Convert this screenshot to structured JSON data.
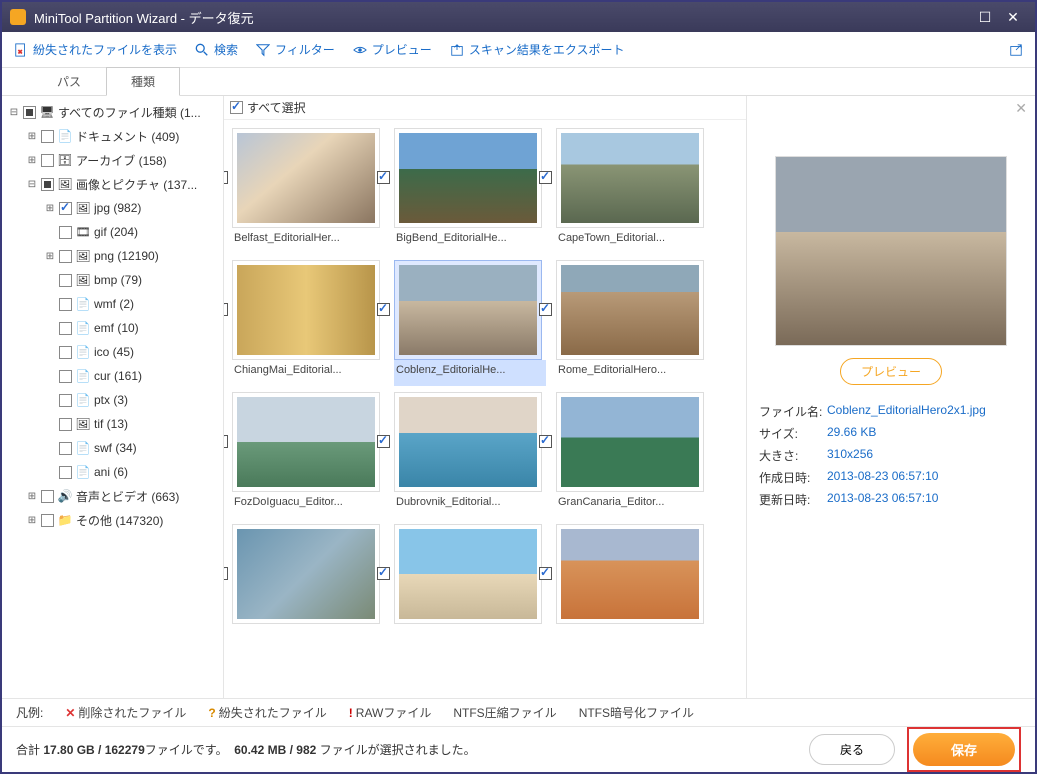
{
  "title": "MiniTool Partition Wizard - データ復元",
  "toolbar": {
    "show_lost": "紛失されたファイルを表示",
    "search": "検索",
    "filter": "フィルター",
    "preview": "プレビュー",
    "export": "スキャン結果をエクスポート"
  },
  "tabs": {
    "path": "パス",
    "type": "種類"
  },
  "tree": [
    {
      "depth": 0,
      "exp": "−",
      "cb": "partial",
      "icon": "🖥",
      "label": "すべてのファイル種類 (1..."
    },
    {
      "depth": 1,
      "exp": "+",
      "cb": "",
      "icon": "📄",
      "label": "ドキュメント (409)"
    },
    {
      "depth": 1,
      "exp": "+",
      "cb": "",
      "icon": "🗄",
      "label": "アーカイブ (158)"
    },
    {
      "depth": 1,
      "exp": "−",
      "cb": "partial",
      "icon": "🖼",
      "label": "画像とピクチャ (137..."
    },
    {
      "depth": 2,
      "exp": "+",
      "cb": "checked",
      "icon": "🖼",
      "label": "jpg (982)"
    },
    {
      "depth": 2,
      "exp": "",
      "cb": "",
      "icon": "🎞",
      "label": "gif (204)"
    },
    {
      "depth": 2,
      "exp": "+",
      "cb": "",
      "icon": "🖼",
      "label": "png (12190)"
    },
    {
      "depth": 2,
      "exp": "",
      "cb": "",
      "icon": "🖼",
      "label": "bmp (79)"
    },
    {
      "depth": 2,
      "exp": "",
      "cb": "",
      "icon": "📄",
      "label": "wmf (2)"
    },
    {
      "depth": 2,
      "exp": "",
      "cb": "",
      "icon": "📄",
      "label": "emf (10)"
    },
    {
      "depth": 2,
      "exp": "",
      "cb": "",
      "icon": "📄",
      "label": "ico (45)"
    },
    {
      "depth": 2,
      "exp": "",
      "cb": "",
      "icon": "📄",
      "label": "cur (161)"
    },
    {
      "depth": 2,
      "exp": "",
      "cb": "",
      "icon": "📄",
      "label": "ptx (3)"
    },
    {
      "depth": 2,
      "exp": "",
      "cb": "",
      "icon": "🖼",
      "label": "tif (13)"
    },
    {
      "depth": 2,
      "exp": "",
      "cb": "",
      "icon": "📄",
      "label": "swf (34)"
    },
    {
      "depth": 2,
      "exp": "",
      "cb": "",
      "icon": "📄",
      "label": "ani (6)"
    },
    {
      "depth": 1,
      "exp": "+",
      "cb": "",
      "icon": "🔊",
      "label": "音声とビデオ (663)"
    },
    {
      "depth": 1,
      "exp": "+",
      "cb": "",
      "icon": "📁",
      "label": "その他 (147320)"
    }
  ],
  "select_all": "すべて選択",
  "thumbs": [
    {
      "name": "Belfast_EditorialHer...",
      "g": "g1",
      "sel": false
    },
    {
      "name": "BigBend_EditorialHe...",
      "g": "g2",
      "sel": false
    },
    {
      "name": "CapeTown_Editorial...",
      "g": "g3",
      "sel": false
    },
    {
      "name": "ChiangMai_Editorial...",
      "g": "g4",
      "sel": false
    },
    {
      "name": "Coblenz_EditorialHe...",
      "g": "g5",
      "sel": true
    },
    {
      "name": "Rome_EditorialHero...",
      "g": "g6",
      "sel": false
    },
    {
      "name": "FozDoIguacu_Editor...",
      "g": "g7",
      "sel": false
    },
    {
      "name": "Dubrovnik_Editorial...",
      "g": "g8",
      "sel": false
    },
    {
      "name": "GranCanaria_Editor...",
      "g": "g9",
      "sel": false
    },
    {
      "name": "",
      "g": "g10",
      "sel": false
    },
    {
      "name": "",
      "g": "g11",
      "sel": false
    },
    {
      "name": "",
      "g": "g12",
      "sel": false
    }
  ],
  "preview": {
    "button": "プレビュー",
    "meta": [
      {
        "k": "ファイル名:",
        "v": "Coblenz_EditorialHero2x1.jpg"
      },
      {
        "k": "サイズ:",
        "v": "29.66 KB"
      },
      {
        "k": "大きさ:",
        "v": "310x256"
      },
      {
        "k": "作成日時:",
        "v": "2013-08-23 06:57:10"
      },
      {
        "k": "更新日時:",
        "v": "2013-08-23 06:57:10"
      }
    ]
  },
  "legend": {
    "title": "凡例:",
    "deleted": "削除されたファイル",
    "lost": "紛失されたファイル",
    "raw": "RAWファイル",
    "ntfs_comp": "NTFS圧縮ファイル",
    "ntfs_enc": "NTFS暗号化ファイル"
  },
  "footer": {
    "status_a": "合計 ",
    "status_b": "17.80 GB / 162279",
    "status_c": "ファイルです。",
    "status_d": "60.42 MB / 982",
    "status_e": " ファイルが選択されました。",
    "back": "戻る",
    "save": "保存"
  }
}
